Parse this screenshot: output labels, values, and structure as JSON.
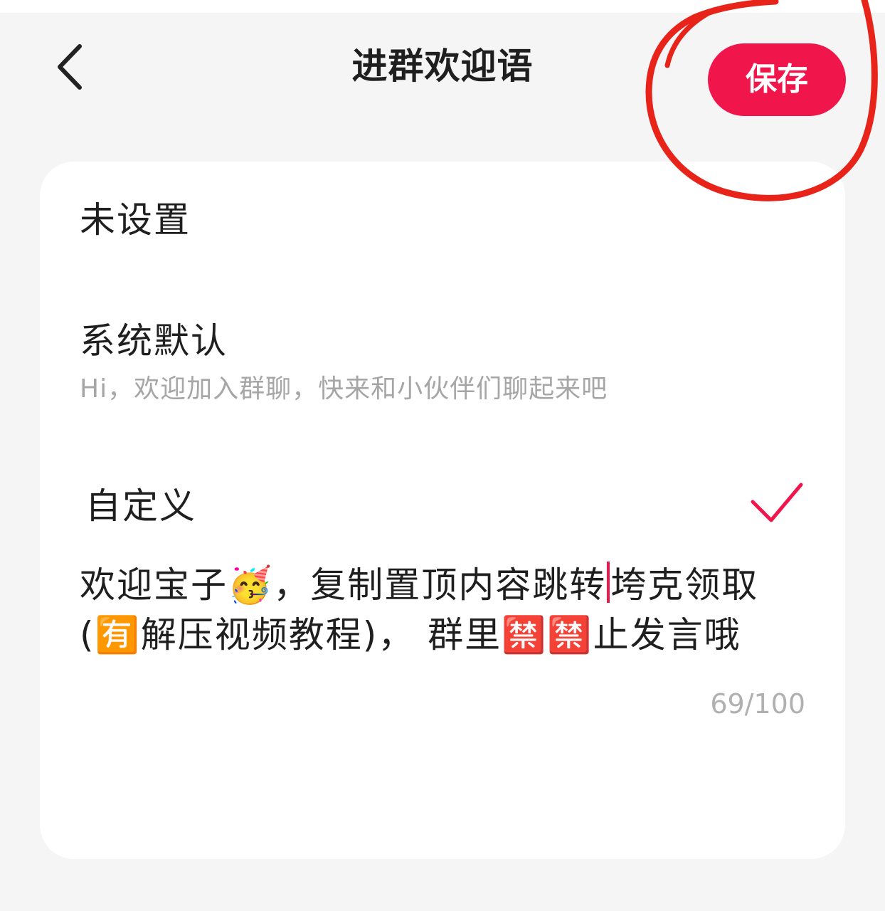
{
  "nav": {
    "back_icon": "chevron-left-icon",
    "title": "进群欢迎语",
    "save_label": "保存"
  },
  "options": {
    "unset": {
      "label": "未设置"
    },
    "default": {
      "label": "系统默认",
      "description": "Hi，欢迎加入群聊，快来和小伙伴们聊起来吧"
    },
    "custom": {
      "label": "自定义",
      "selected": true,
      "check_icon": "checkmark-icon",
      "text_before_caret": "欢迎宝子🥳，复制置顶内容跳转",
      "text_after_caret": "垮克领取(🈶解压视频教程)， 群里🈲🈲止发言哦",
      "counter": "69/100"
    }
  },
  "colors": {
    "accent": "#f0154a",
    "annotation": "#e8231a",
    "background": "#f5f5f5",
    "card": "#ffffff",
    "secondary_text": "#a6a6a6"
  }
}
